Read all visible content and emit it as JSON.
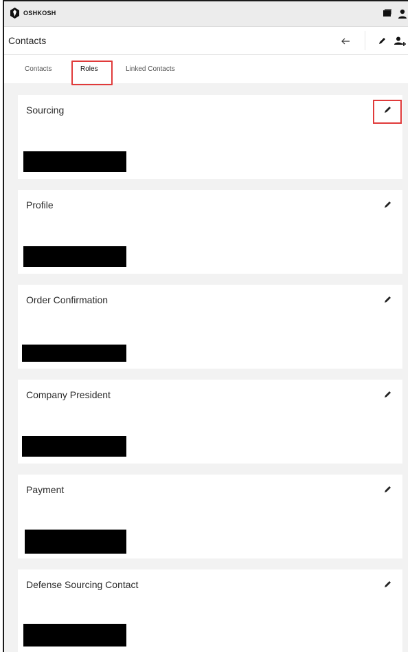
{
  "app": {
    "brand": "OSHKOSH"
  },
  "header": {
    "title": "Contacts"
  },
  "tabs": [
    {
      "label": "Contacts",
      "active": false
    },
    {
      "label": "Roles",
      "active": true
    },
    {
      "label": "Linked Contacts",
      "active": false
    }
  ],
  "roles": [
    {
      "title": "Sourcing"
    },
    {
      "title": "Profile"
    },
    {
      "title": "Order Confirmation"
    },
    {
      "title": "Company President"
    },
    {
      "title": "Payment"
    },
    {
      "title": "Defense Sourcing Contact"
    }
  ],
  "colors": {
    "highlight": "#e03a3a",
    "background": "#f2f2f2",
    "card": "#ffffff"
  },
  "icons": {
    "logo": "oshkosh-logo-icon",
    "top_right": [
      "chat-icon",
      "user-icon"
    ],
    "header": [
      "back-arrow-icon",
      "pencil-icon",
      "add-user-icon"
    ],
    "card": "pencil-icon"
  }
}
